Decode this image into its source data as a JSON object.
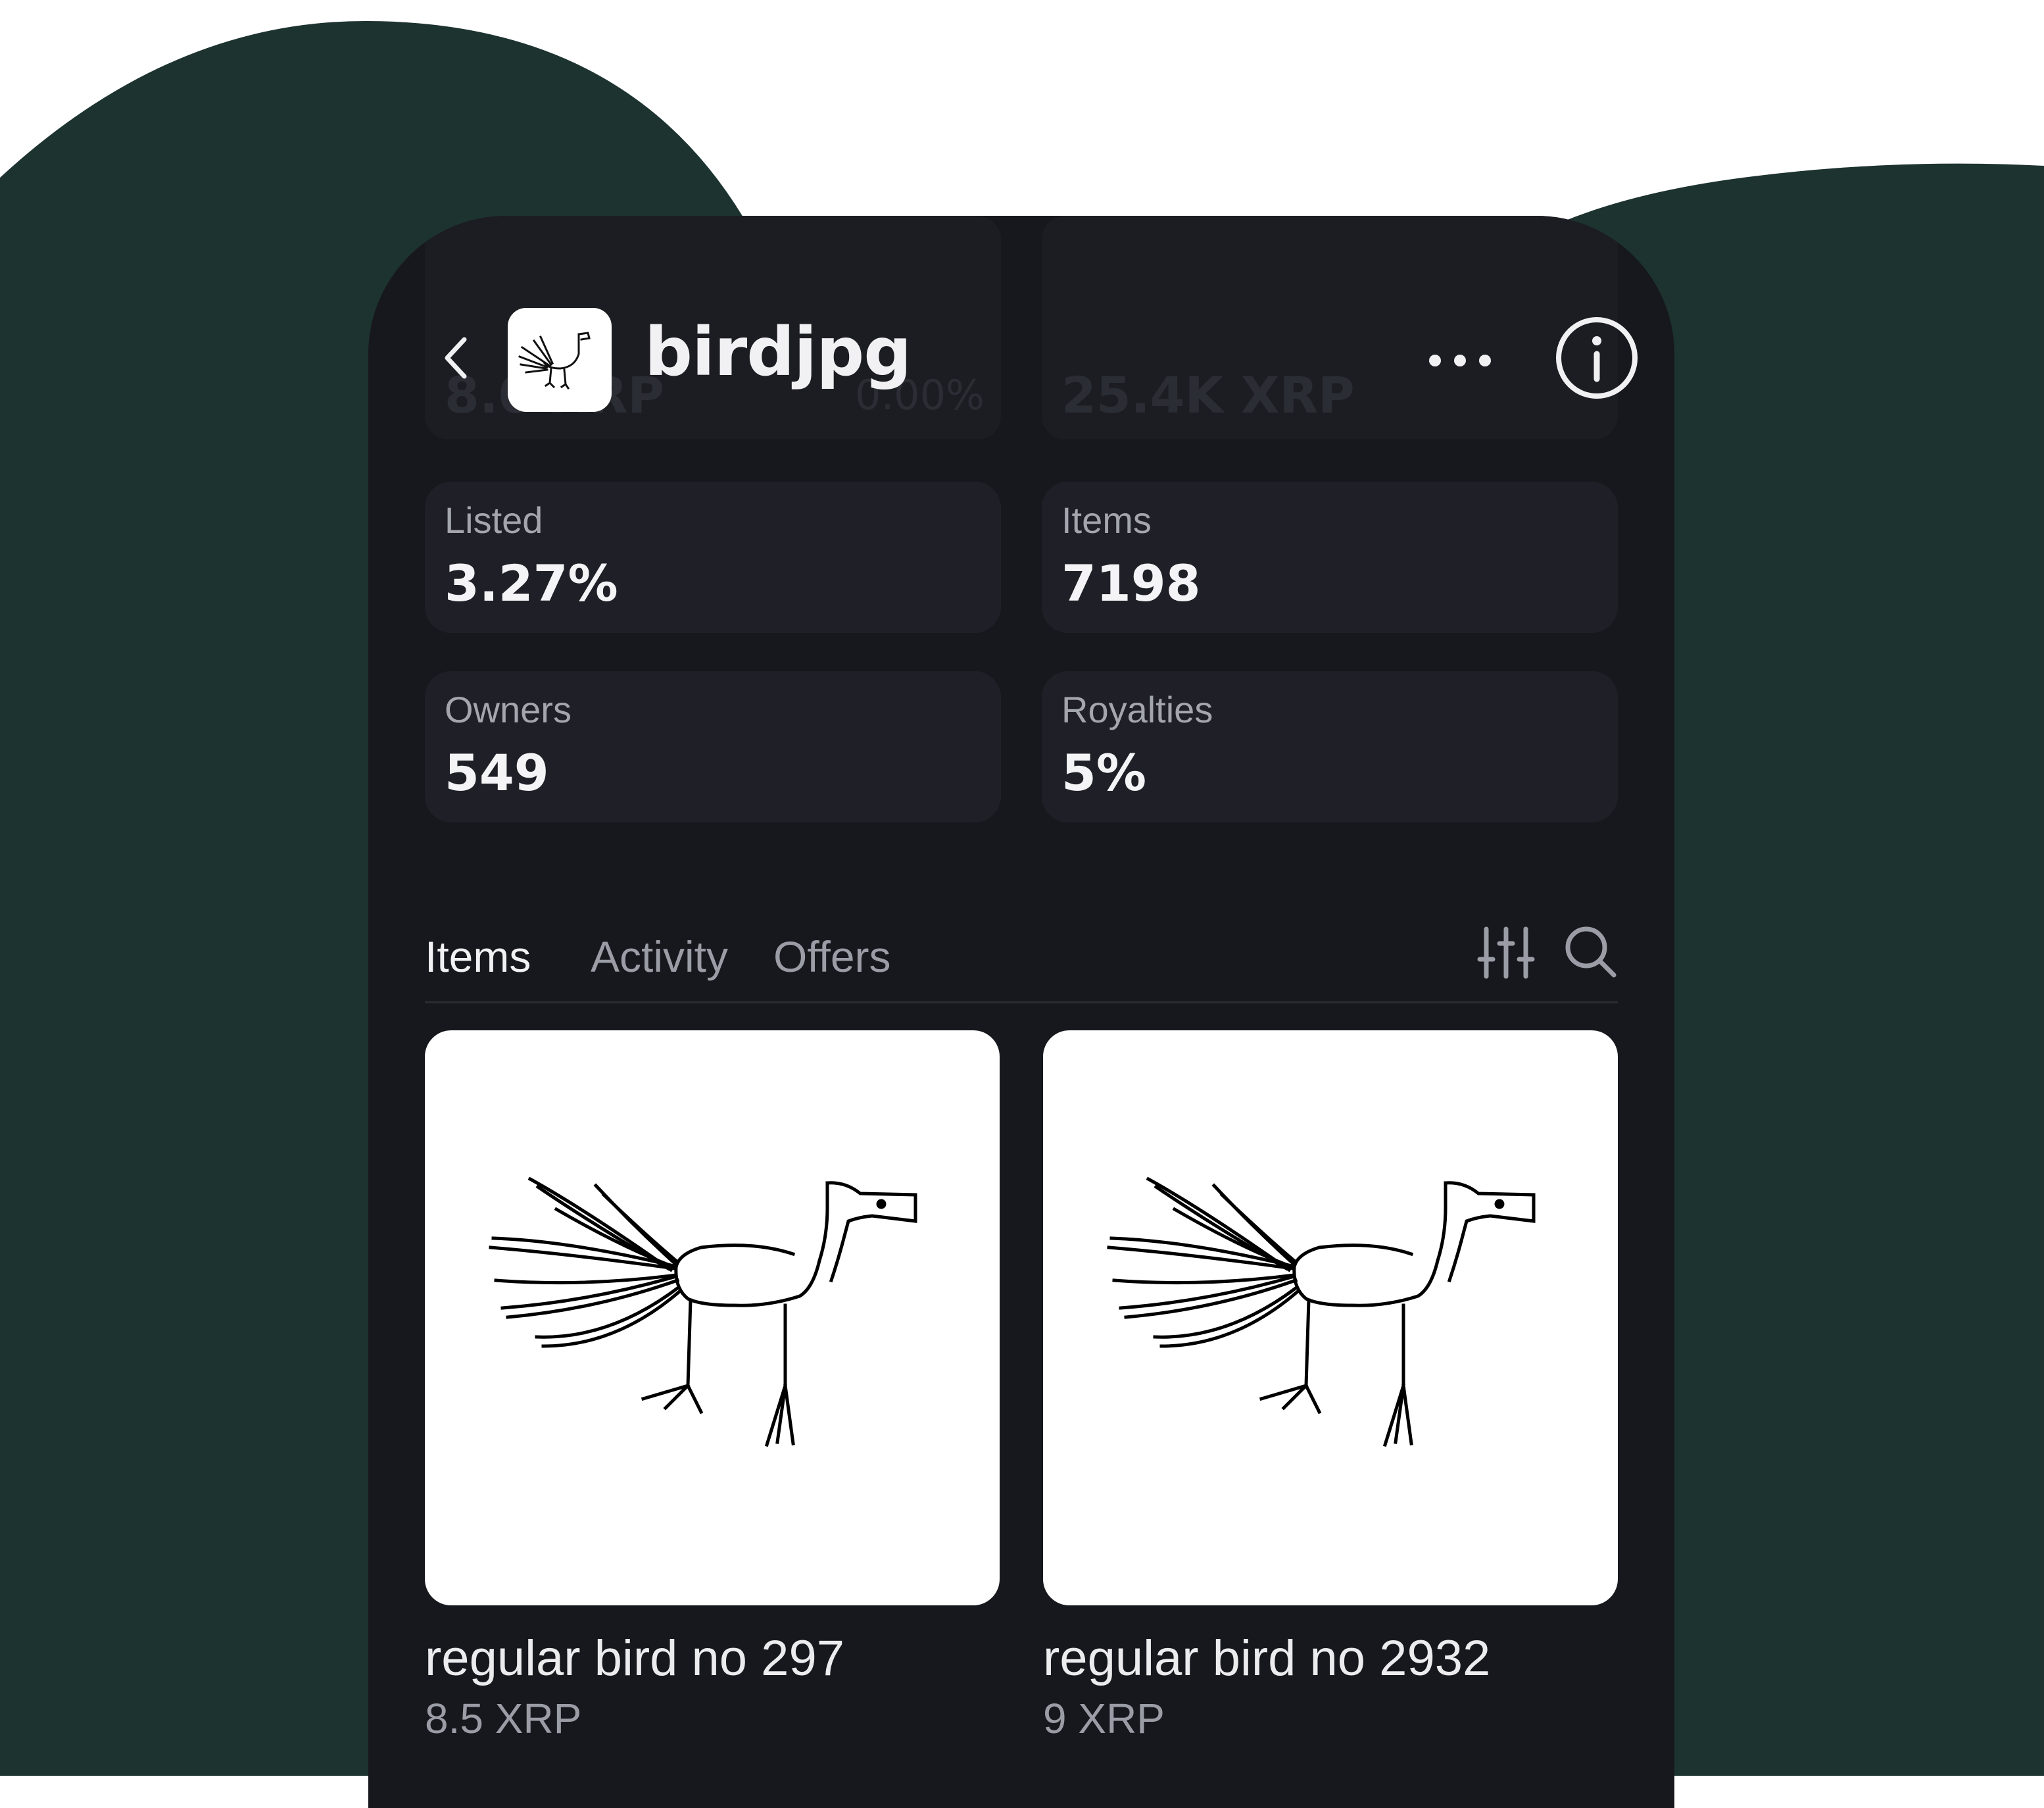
{
  "colors": {
    "background_shape": "#1d3330",
    "phone_bg": "#17181d",
    "card_bg": "#1f2027",
    "text_primary": "#f1f1f3",
    "text_secondary": "#9b9da6"
  },
  "header": {
    "title": "birdjpg",
    "back_icon": "chevron-left-icon",
    "more_icon": "more-horizontal-icon",
    "info_icon": "info-icon",
    "ghost_floor_value": "8.0 XRP",
    "ghost_floor_change": "0.00%",
    "ghost_volume_value": "25.4K XRP"
  },
  "stats": [
    {
      "label": "Listed",
      "value": "3.27%"
    },
    {
      "label": "Items",
      "value": "7198"
    },
    {
      "label": "Owners",
      "value": "549"
    },
    {
      "label": "Royalties",
      "value": "5%"
    }
  ],
  "tabs": [
    {
      "label": "Items",
      "active": true
    },
    {
      "label": "Activity",
      "active": false
    },
    {
      "label": "Offers",
      "active": false
    }
  ],
  "toolbar": {
    "filter_icon": "sliders-icon",
    "search_icon": "search-icon"
  },
  "items": [
    {
      "name": "regular bird no 297",
      "price": "8.5 XRP"
    },
    {
      "name": "regular bird no 2932",
      "price": "9 XRP"
    }
  ]
}
